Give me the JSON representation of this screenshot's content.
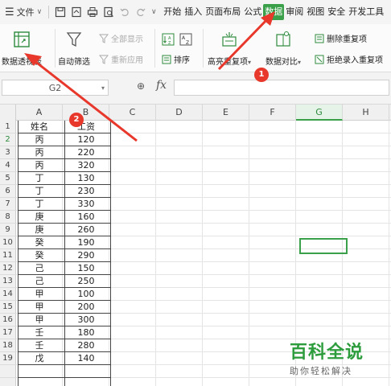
{
  "menubar": {
    "file_label": "文件",
    "tabs": [
      {
        "label": "开始"
      },
      {
        "label": "插入"
      },
      {
        "label": "页面布局"
      },
      {
        "label": "公式"
      },
      {
        "label": "数据",
        "active": true
      },
      {
        "label": "审阅"
      },
      {
        "label": "视图"
      },
      {
        "label": "安全"
      },
      {
        "label": "开发工具"
      }
    ]
  },
  "ribbon": {
    "pivot_table": "数据透视表",
    "auto_filter": "自动筛选",
    "show_all": "全部显示",
    "reapply": "重新应用",
    "sort": "排序",
    "highlight_dup": "高亮重复项",
    "data_compare": "数据对比",
    "remove_dup": "删除重复项",
    "reject_dup": "拒绝录入重复项"
  },
  "formula_bar": {
    "name_box": "G2",
    "fx_label": "fx",
    "formula": ""
  },
  "grid": {
    "columns": [
      "A",
      "B",
      "C",
      "D",
      "E",
      "F",
      "G",
      "H"
    ],
    "selected_column": "G",
    "selected_row": "2",
    "rows": [
      {
        "row": "1",
        "a": "姓名",
        "b": "工资"
      },
      {
        "row": "2",
        "a": "丙",
        "b": "120"
      },
      {
        "row": "3",
        "a": "丙",
        "b": "220"
      },
      {
        "row": "4",
        "a": "丙",
        "b": "320"
      },
      {
        "row": "5",
        "a": "丁",
        "b": "130"
      },
      {
        "row": "6",
        "a": "丁",
        "b": "230"
      },
      {
        "row": "7",
        "a": "丁",
        "b": "330"
      },
      {
        "row": "8",
        "a": "庚",
        "b": "160"
      },
      {
        "row": "9",
        "a": "庚",
        "b": "260"
      },
      {
        "row": "10",
        "a": "癸",
        "b": "190"
      },
      {
        "row": "11",
        "a": "癸",
        "b": "290"
      },
      {
        "row": "12",
        "a": "己",
        "b": "150"
      },
      {
        "row": "13",
        "a": "己",
        "b": "250"
      },
      {
        "row": "14",
        "a": "甲",
        "b": "100"
      },
      {
        "row": "15",
        "a": "甲",
        "b": "200"
      },
      {
        "row": "16",
        "a": "甲",
        "b": "300"
      },
      {
        "row": "17",
        "a": "壬",
        "b": "180"
      },
      {
        "row": "18",
        "a": "壬",
        "b": "280"
      },
      {
        "row": "19",
        "a": "戊",
        "b": "140"
      }
    ]
  },
  "annotations": {
    "badge1": "1",
    "badge2": "2",
    "arrow_color": "#e8382b"
  },
  "watermark": {
    "title": "百科全说",
    "subtitle": "助你轻松解决"
  },
  "colors": {
    "accent": "#3aa04a",
    "annotation": "#e8382b"
  }
}
